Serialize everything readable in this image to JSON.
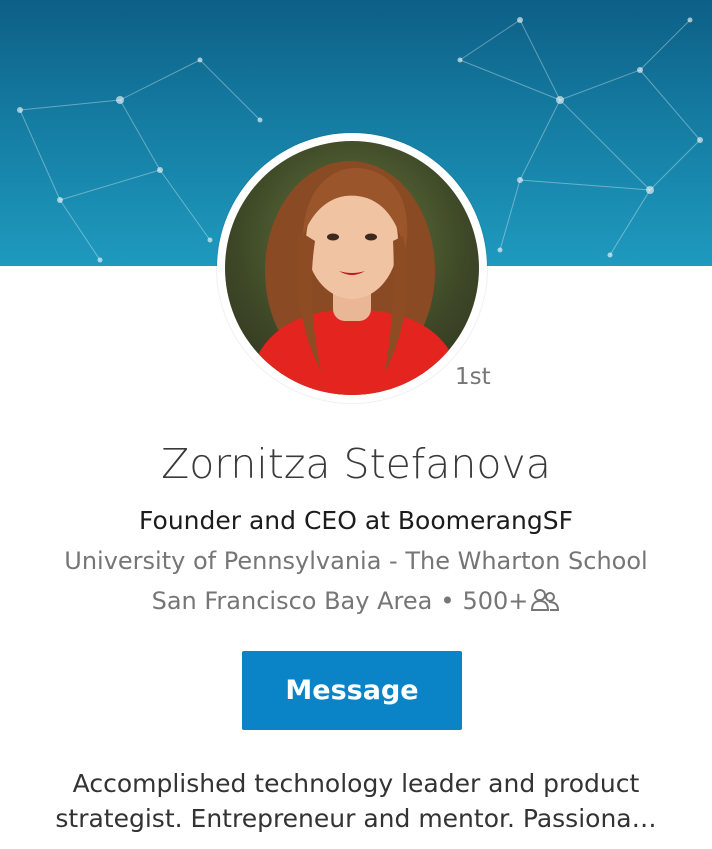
{
  "profile": {
    "name": "Zornitza Stefanova",
    "headline": "Founder and CEO at BoomerangSF",
    "school": "University of Pennsylvania - The Wharton School",
    "location": "San Francisco Bay Area",
    "separator": "•",
    "connections": "500+",
    "degree": "1st",
    "summary_line1": "Accomplished technology leader and product",
    "summary_line2": "strategist. Entrepreneur and mentor. Passiona…"
  },
  "actions": {
    "message_label": "Message"
  },
  "icons": {
    "connections": "people-icon"
  },
  "colors": {
    "accent": "#0a84c7",
    "banner": "#1a8ab4"
  }
}
